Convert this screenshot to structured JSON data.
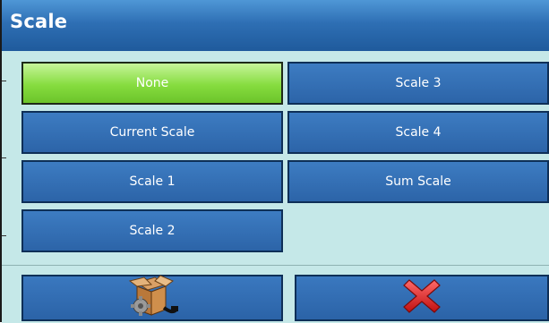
{
  "dialog": {
    "title": "Scale"
  },
  "options": [
    {
      "label": "None",
      "selected": true
    },
    {
      "label": "Scale 3",
      "selected": false
    },
    {
      "label": "Current Scale",
      "selected": false
    },
    {
      "label": "Scale 4",
      "selected": false
    },
    {
      "label": "Scale 1",
      "selected": false
    },
    {
      "label": "Sum Scale",
      "selected": false
    },
    {
      "label": "Scale 2",
      "selected": false
    }
  ],
  "footer": {
    "left_icon": "scale-setup-box-icon",
    "right_icon": "red-x-cancel-icon"
  },
  "colors": {
    "title_bar": "#2e6fb4",
    "button_blue": "#2c64a8",
    "selected_green": "#86dc3f",
    "background": "#c5e8e8",
    "cancel_red": "#e02020"
  }
}
